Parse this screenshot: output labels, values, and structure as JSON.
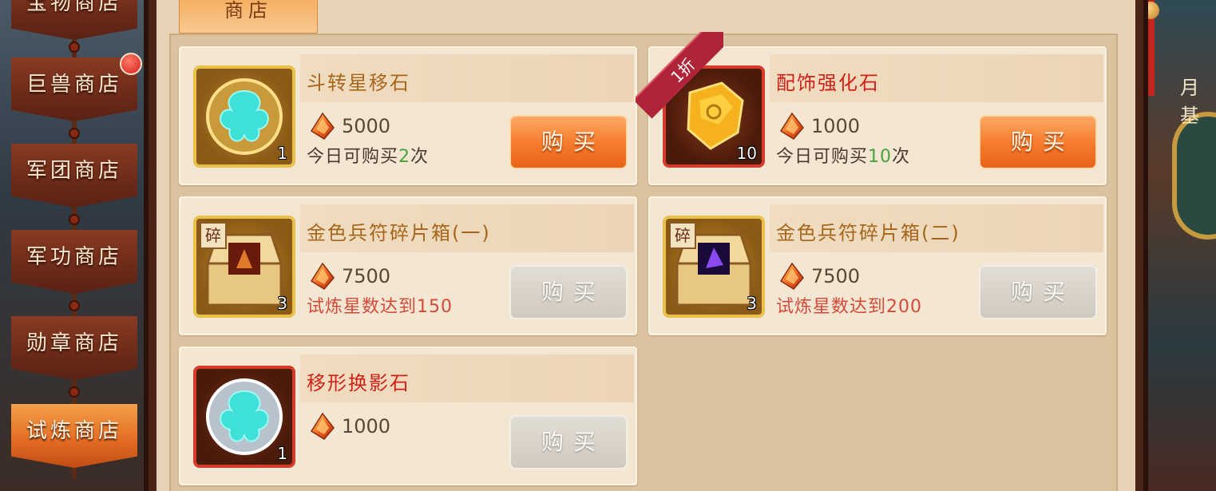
{
  "sidebar": {
    "items": [
      {
        "label": "宝物商店",
        "active": false
      },
      {
        "label": "巨兽商店",
        "active": false,
        "badge": true
      },
      {
        "label": "军团商店",
        "active": false
      },
      {
        "label": "军功商店",
        "active": false
      },
      {
        "label": "勋章商店",
        "active": false
      },
      {
        "label": "试炼商店",
        "active": true
      }
    ]
  },
  "tab": {
    "label": "商店"
  },
  "background": {
    "right_sign": "月基"
  },
  "shop": {
    "items": [
      {
        "name": "斗转星移石",
        "name_color": "gold",
        "qty": "1",
        "price": "5000",
        "limit_prefix": "今日可购买",
        "limit_count": "2",
        "limit_suffix": "次",
        "buy_label": "购买",
        "buy_enabled": true
      },
      {
        "name": "配饰强化石",
        "name_color": "red",
        "qty": "10",
        "price": "1000",
        "limit_prefix": "今日可购买",
        "limit_count": "10",
        "limit_suffix": "次",
        "buy_label": "购买",
        "buy_enabled": true,
        "discount": "1折"
      },
      {
        "name": "金色兵符碎片箱(一)",
        "name_color": "gold",
        "qty": "3",
        "shard_tag": "碎",
        "price": "7500",
        "requirement": "试炼星数达到150",
        "buy_label": "购买",
        "buy_enabled": false
      },
      {
        "name": "金色兵符碎片箱(二)",
        "name_color": "gold",
        "qty": "3",
        "shard_tag": "碎",
        "price": "7500",
        "requirement": "试炼星数达到200",
        "buy_label": "购买",
        "buy_enabled": false
      },
      {
        "name": "移形换影石",
        "name_color": "red",
        "qty": "1",
        "price": "1000",
        "buy_label": "购买",
        "buy_enabled": false
      }
    ]
  },
  "colors": {
    "accent_orange": "#f57a2a",
    "gold_text": "#a5661c",
    "red_text": "#d02018",
    "count_green": "#4aa23a"
  }
}
